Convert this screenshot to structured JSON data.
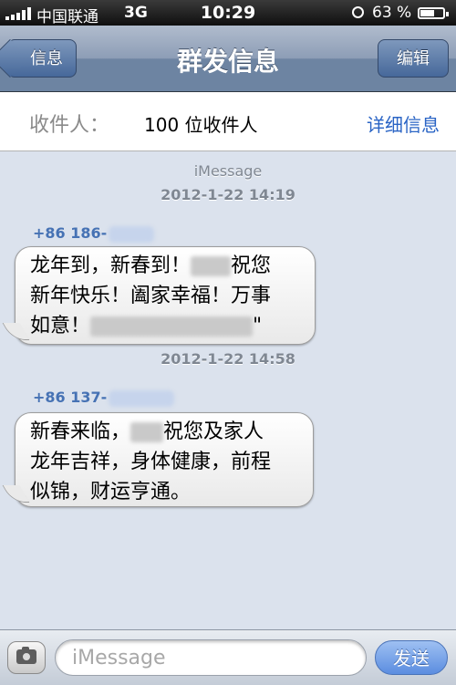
{
  "status_bar": {
    "carrier": "中国联通",
    "network": "3G",
    "time": "10:29",
    "battery_percent": "63 %",
    "battery_level": 0.63
  },
  "nav": {
    "title": "群发信息",
    "back_label": "信息",
    "edit_label": "编辑"
  },
  "recipients": {
    "label": "收件人：",
    "value": "100 位收件人",
    "detail_label": "详细信息"
  },
  "thread": {
    "service": "iMessage",
    "messages": [
      {
        "timestamp": "2012-1-22 14:19",
        "sender": "+86 186-",
        "lines": [
          "龙年到，新春到！",
          "祝您",
          "新年快乐！阖家幸福！万事",
          "如意！",
          "\""
        ]
      },
      {
        "timestamp": "2012-1-22 14:58",
        "sender": "+86 137-",
        "lines": [
          "新春来临，",
          "祝您及家人",
          "龙年吉祥，身体健康，前程",
          "似锦，财运亨通。"
        ]
      }
    ]
  },
  "input": {
    "placeholder": "iMessage",
    "value": "",
    "send_label": "发送"
  },
  "icons": {
    "camera": "camera-icon",
    "signal": "signal-bars-icon",
    "clock": "alarm-icon",
    "battery": "battery-icon"
  },
  "colors": {
    "link": "#2a64c5",
    "sender": "#4672b4",
    "nav": "#6d84a2"
  }
}
